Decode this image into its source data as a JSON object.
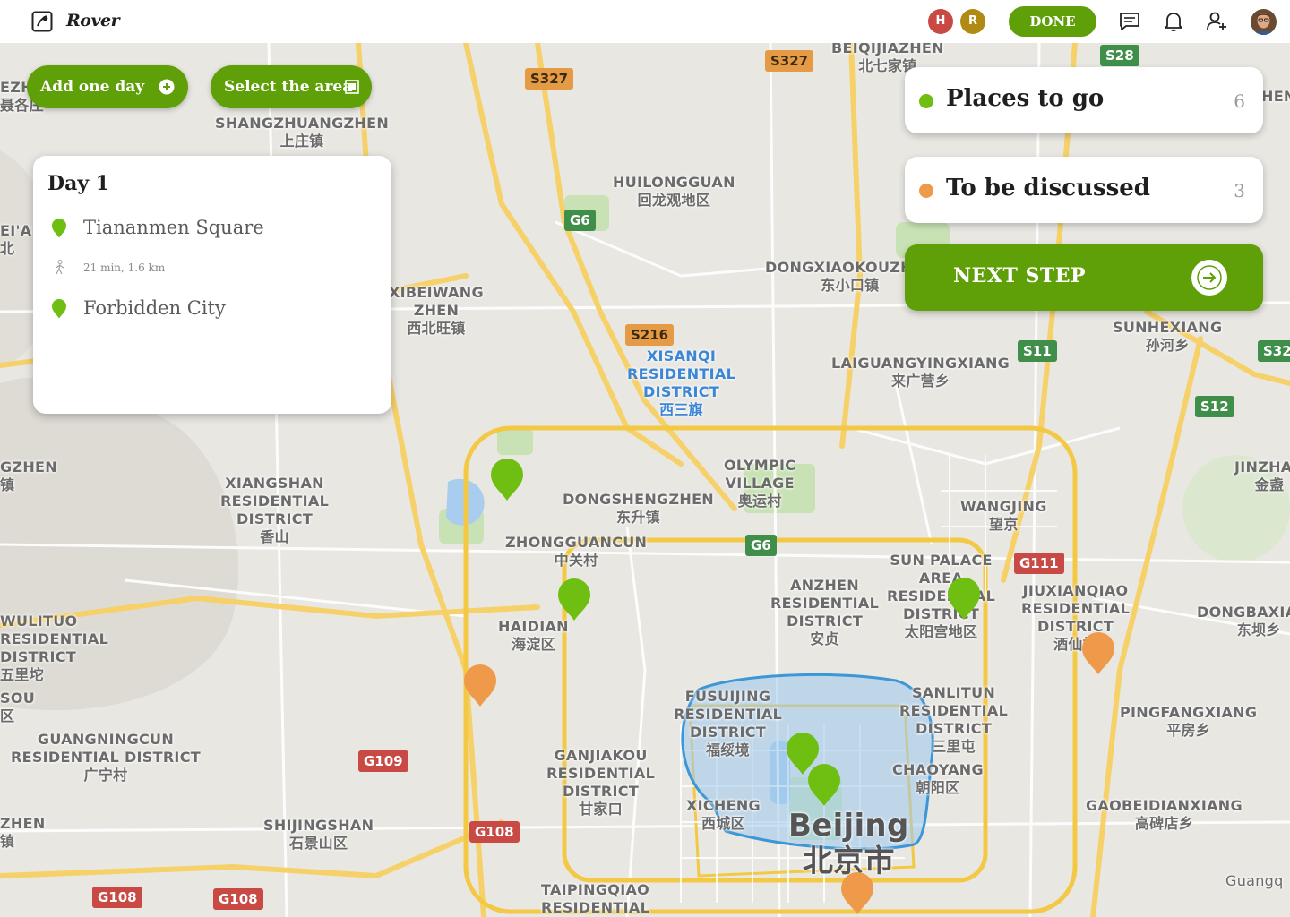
{
  "app": {
    "name": "Rover",
    "logo_icon": "rover-logo-icon"
  },
  "header": {
    "collaborators": [
      {
        "initial": "H",
        "color": "#c94a44"
      },
      {
        "initial": "R",
        "color": "#b08a12"
      }
    ],
    "done_label": "DONE",
    "icons": [
      "chat-icon",
      "bell-icon",
      "add-user-icon",
      "user-avatar"
    ]
  },
  "toolbar": {
    "add_day_label": "Add one day",
    "add_day_icon": "plus-circle-icon",
    "select_area_label": "Select the area",
    "select_area_icon": "select-area-icon"
  },
  "day_card": {
    "title": "Day 1",
    "stops": [
      {
        "name": "Tiananmen Square"
      },
      {
        "name": "Forbidden City"
      }
    ],
    "walk": {
      "icon": "walking-icon",
      "text": "21 min, 1.6 km"
    }
  },
  "categories": [
    {
      "label": "Places to go",
      "count": "6",
      "color": "#6fbf12"
    },
    {
      "label": "To be discussed",
      "count": "3",
      "color": "#ef9a4a"
    }
  ],
  "next_step": {
    "label": "NEXT STEP",
    "icon": "arrow-right-icon"
  },
  "colors": {
    "accent": "#5f9f07",
    "place_pin": "#6fbf12",
    "discuss_pin": "#ef9a4a",
    "area_outline": "#3d97d6"
  },
  "map": {
    "labels": [
      {
        "text": "BEIQIJIAZHEN\n北七家镇"
      },
      {
        "text": "SHANGZHUANGZHEN\n上庄镇"
      },
      {
        "text": "HUILONGGUAN\n回龙观地区"
      },
      {
        "text": "DONGXIAOKOUZHEN\n东小口镇"
      },
      {
        "text": "XIBEIWANG\nZHEN\n西北旺镇"
      },
      {
        "text": "XISANQI\nRESIDENTIAL\nDISTRICT\n西三旗"
      },
      {
        "text": "LAIGUANGYINGXIANG\n来广营乡"
      },
      {
        "text": "SUNHEXIANG\n孙河乡"
      },
      {
        "text": "OLYMPIC\nVILLAGE\n奥运村"
      },
      {
        "text": "DONGSHENGZHEN\n东升镇"
      },
      {
        "text": "ZHONGGUANCUN\n中关村"
      },
      {
        "text": "XIANGSHAN\nRESIDENTIAL\nDISTRICT\n香山"
      },
      {
        "text": "WANGJING\n望京"
      },
      {
        "text": "JINZHAN\n金盏"
      },
      {
        "text": "SUN PALACE\nAREA\nRESIDENTIAL\nDISTRICT\n太阳宫地区"
      },
      {
        "text": "ANZHEN\nRESIDENTIAL\nDISTRICT\n安贞"
      },
      {
        "text": "JIUXIANQIAO\nRESIDENTIAL\nDISTRICT\n酒仙桥"
      },
      {
        "text": "DONGBAXIANG\n东坝乡"
      },
      {
        "text": "HAIDIAN\n海淀区"
      },
      {
        "text": "WULITUO\nRESIDENTIAL\nDISTRICT\n五里坨"
      },
      {
        "text": "FUSUIJING\nRESIDENTIAL\nDISTRICT\n福绥境"
      },
      {
        "text": "SANLITUN\nRESIDENTIAL\nDISTRICT\n三里屯"
      },
      {
        "text": "PINGFANGXIANG\n平房乡"
      },
      {
        "text": "GUANGNINGCUN\nRESIDENTIAL DISTRICT\n广宁村"
      },
      {
        "text": "GANJIAKOU\nRESIDENTIAL\nDISTRICT\n甘家口"
      },
      {
        "text": "CHAOYANG\n朝阳区"
      },
      {
        "text": "XICHENG\n西城区"
      },
      {
        "text": "GAOBEIDIANXIANG\n高碑店乡"
      },
      {
        "text": "SHIJINGSHAN\n石景山区"
      },
      {
        "text": "TAIPINGQIAO\nRESIDENTIAL"
      },
      {
        "text": "Beijing\n北京市"
      },
      {
        "text": "EZH\n聂各庄"
      },
      {
        "text": "EI'AN\n北"
      },
      {
        "text": "GZHEN\n镇"
      },
      {
        "text": "SOU\n区"
      },
      {
        "text": "ZHEN\n镇"
      },
      {
        "text": "HEN"
      },
      {
        "text": "Guangq"
      }
    ],
    "shields": [
      {
        "text": "S327"
      },
      {
        "text": "S327"
      },
      {
        "text": "S28"
      },
      {
        "text": "G6"
      },
      {
        "text": "S216"
      },
      {
        "text": "S11"
      },
      {
        "text": "S32"
      },
      {
        "text": "S12"
      },
      {
        "text": "G6"
      },
      {
        "text": "G111"
      },
      {
        "text": "G109"
      },
      {
        "text": "G108"
      },
      {
        "text": "G108"
      },
      {
        "text": "G108"
      }
    ],
    "pins": [
      {
        "type": "place"
      },
      {
        "type": "place"
      },
      {
        "type": "place"
      },
      {
        "type": "place"
      },
      {
        "type": "place"
      },
      {
        "type": "discuss"
      },
      {
        "type": "discuss"
      },
      {
        "type": "discuss"
      }
    ]
  }
}
